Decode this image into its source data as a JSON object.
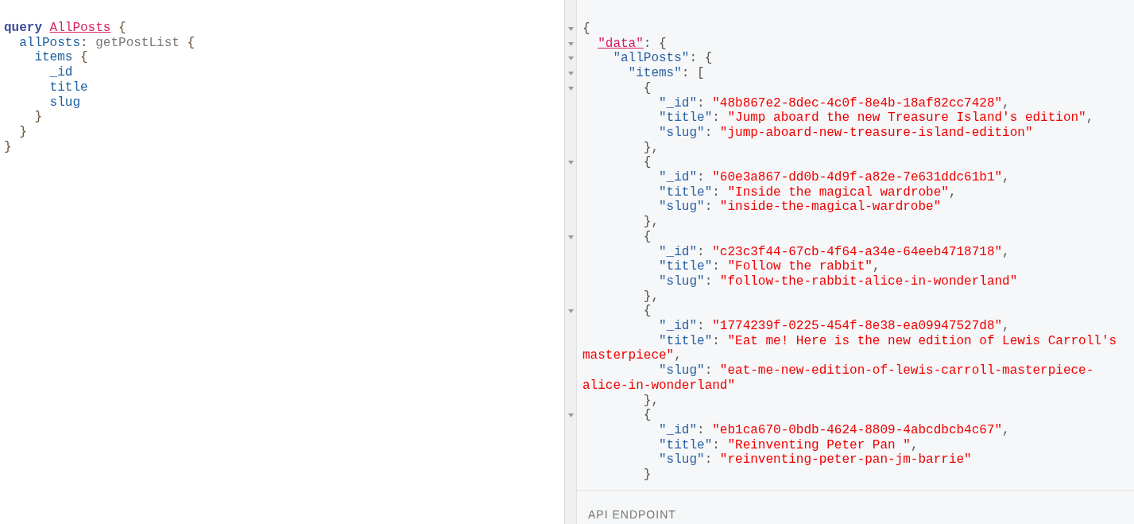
{
  "query_editor": {
    "lines": [
      {
        "tokens": [
          {
            "kind": "keyword",
            "text": "query "
          },
          {
            "kind": "def",
            "text": "AllPosts"
          },
          {
            "kind": "brace",
            "text": " {"
          }
        ],
        "children": [
          {
            "tokens": [
              {
                "kind": "alias",
                "text": "allPosts"
              },
              {
                "kind": "punct",
                "text": ": "
              },
              {
                "kind": "field",
                "text": "getPostList"
              },
              {
                "kind": "brace",
                "text": " {"
              }
            ],
            "children": [
              {
                "tokens": [
                  {
                    "kind": "property",
                    "text": "items"
                  },
                  {
                    "kind": "brace",
                    "text": " {"
                  }
                ],
                "children": [
                  {
                    "tokens": [
                      {
                        "kind": "property",
                        "text": "_id"
                      }
                    ]
                  },
                  {
                    "tokens": [
                      {
                        "kind": "property",
                        "text": "title"
                      }
                    ]
                  },
                  {
                    "tokens": [
                      {
                        "kind": "property",
                        "text": "slug"
                      }
                    ]
                  }
                ]
              },
              {
                "tokens": [
                  {
                    "kind": "brace",
                    "text": "}"
                  }
                ]
              }
            ]
          },
          {
            "tokens": [
              {
                "kind": "brace",
                "text": "}"
              }
            ]
          }
        ]
      },
      {
        "tokens": [
          {
            "kind": "brace",
            "text": "}"
          }
        ]
      }
    ]
  },
  "result_viewer": {
    "lines": [
      {
        "tokens": [
          {
            "kind": "punct",
            "text": "{"
          }
        ],
        "children": [
          {
            "tokens": [
              {
                "kind": "key_link",
                "text": "\"data\""
              },
              {
                "kind": "punct",
                "text": ": {"
              }
            ],
            "children": [
              {
                "tokens": [
                  {
                    "kind": "key",
                    "text": "\"allPosts\""
                  },
                  {
                    "kind": "punct",
                    "text": ": {"
                  }
                ],
                "children": [
                  {
                    "tokens": [
                      {
                        "kind": "key",
                        "text": "\"items\""
                      },
                      {
                        "kind": "punct",
                        "text": ": ["
                      }
                    ],
                    "children": [
                      {
                        "tokens": [
                          {
                            "kind": "punct",
                            "text": "{"
                          }
                        ],
                        "children": [
                          {
                            "tokens": [
                              {
                                "kind": "key",
                                "text": "\"_id\""
                              },
                              {
                                "kind": "punct",
                                "text": ": "
                              },
                              {
                                "kind": "string",
                                "text": "\"48b867e2-8dec-4c0f-8e4b-18af82cc7428\""
                              },
                              {
                                "kind": "punct",
                                "text": ","
                              }
                            ]
                          },
                          {
                            "tokens": [
                              {
                                "kind": "key",
                                "text": "\"title\""
                              },
                              {
                                "kind": "punct",
                                "text": ": "
                              },
                              {
                                "kind": "string",
                                "text": "\"Jump aboard the new Treasure Island's edition\""
                              },
                              {
                                "kind": "punct",
                                "text": ","
                              }
                            ]
                          },
                          {
                            "tokens": [
                              {
                                "kind": "key",
                                "text": "\"slug\""
                              },
                              {
                                "kind": "punct",
                                "text": ": "
                              },
                              {
                                "kind": "string",
                                "text": "\"jump-aboard-new-treasure-island-edition\""
                              }
                            ]
                          }
                        ]
                      },
                      {
                        "tokens": [
                          {
                            "kind": "punct",
                            "text": "},"
                          }
                        ]
                      },
                      {
                        "tokens": [
                          {
                            "kind": "punct",
                            "text": "{"
                          }
                        ],
                        "children": [
                          {
                            "tokens": [
                              {
                                "kind": "key",
                                "text": "\"_id\""
                              },
                              {
                                "kind": "punct",
                                "text": ": "
                              },
                              {
                                "kind": "string",
                                "text": "\"60e3a867-dd0b-4d9f-a82e-7e631ddc61b1\""
                              },
                              {
                                "kind": "punct",
                                "text": ","
                              }
                            ]
                          },
                          {
                            "tokens": [
                              {
                                "kind": "key",
                                "text": "\"title\""
                              },
                              {
                                "kind": "punct",
                                "text": ": "
                              },
                              {
                                "kind": "string",
                                "text": "\"Inside the magical wardrobe\""
                              },
                              {
                                "kind": "punct",
                                "text": ","
                              }
                            ]
                          },
                          {
                            "tokens": [
                              {
                                "kind": "key",
                                "text": "\"slug\""
                              },
                              {
                                "kind": "punct",
                                "text": ": "
                              },
                              {
                                "kind": "string",
                                "text": "\"inside-the-magical-wardrobe\""
                              }
                            ]
                          }
                        ]
                      },
                      {
                        "tokens": [
                          {
                            "kind": "punct",
                            "text": "},"
                          }
                        ]
                      },
                      {
                        "tokens": [
                          {
                            "kind": "punct",
                            "text": "{"
                          }
                        ],
                        "children": [
                          {
                            "tokens": [
                              {
                                "kind": "key",
                                "text": "\"_id\""
                              },
                              {
                                "kind": "punct",
                                "text": ": "
                              },
                              {
                                "kind": "string",
                                "text": "\"c23c3f44-67cb-4f64-a34e-64eeb4718718\""
                              },
                              {
                                "kind": "punct",
                                "text": ","
                              }
                            ]
                          },
                          {
                            "tokens": [
                              {
                                "kind": "key",
                                "text": "\"title\""
                              },
                              {
                                "kind": "punct",
                                "text": ": "
                              },
                              {
                                "kind": "string",
                                "text": "\"Follow the rabbit\""
                              },
                              {
                                "kind": "punct",
                                "text": ","
                              }
                            ]
                          },
                          {
                            "tokens": [
                              {
                                "kind": "key",
                                "text": "\"slug\""
                              },
                              {
                                "kind": "punct",
                                "text": ": "
                              },
                              {
                                "kind": "string",
                                "text": "\"follow-the-rabbit-alice-in-wonderland\""
                              }
                            ]
                          }
                        ]
                      },
                      {
                        "tokens": [
                          {
                            "kind": "punct",
                            "text": "},"
                          }
                        ]
                      },
                      {
                        "tokens": [
                          {
                            "kind": "punct",
                            "text": "{"
                          }
                        ],
                        "children": [
                          {
                            "tokens": [
                              {
                                "kind": "key",
                                "text": "\"_id\""
                              },
                              {
                                "kind": "punct",
                                "text": ": "
                              },
                              {
                                "kind": "string",
                                "text": "\"1774239f-0225-454f-8e38-ea09947527d8\""
                              },
                              {
                                "kind": "punct",
                                "text": ","
                              }
                            ]
                          },
                          {
                            "tokens": [
                              {
                                "kind": "key",
                                "text": "\"title\""
                              },
                              {
                                "kind": "punct",
                                "text": ": "
                              },
                              {
                                "kind": "string",
                                "text": "\"Eat me! Here is the new edition of Lewis Carroll's masterpiece\""
                              },
                              {
                                "kind": "punct",
                                "text": ","
                              }
                            ]
                          },
                          {
                            "tokens": [
                              {
                                "kind": "key",
                                "text": "\"slug\""
                              },
                              {
                                "kind": "punct",
                                "text": ": "
                              },
                              {
                                "kind": "string",
                                "text": "\"eat-me-new-edition-of-lewis-carroll-masterpiece-alice-in-wonderland\""
                              }
                            ]
                          }
                        ]
                      },
                      {
                        "tokens": [
                          {
                            "kind": "punct",
                            "text": "},"
                          }
                        ]
                      },
                      {
                        "tokens": [
                          {
                            "kind": "punct",
                            "text": "{"
                          }
                        ],
                        "children": [
                          {
                            "tokens": [
                              {
                                "kind": "key",
                                "text": "\"_id\""
                              },
                              {
                                "kind": "punct",
                                "text": ": "
                              },
                              {
                                "kind": "string",
                                "text": "\"eb1ca670-0bdb-4624-8809-4abcdbcb4c67\""
                              },
                              {
                                "kind": "punct",
                                "text": ","
                              }
                            ]
                          },
                          {
                            "tokens": [
                              {
                                "kind": "key",
                                "text": "\"title\""
                              },
                              {
                                "kind": "punct",
                                "text": ": "
                              },
                              {
                                "kind": "string",
                                "text": "\"Reinventing Peter Pan \""
                              },
                              {
                                "kind": "punct",
                                "text": ","
                              }
                            ]
                          },
                          {
                            "tokens": [
                              {
                                "kind": "key",
                                "text": "\"slug\""
                              },
                              {
                                "kind": "punct",
                                "text": ": "
                              },
                              {
                                "kind": "string",
                                "text": "\"reinventing-peter-pan-jm-barrie\""
                              }
                            ]
                          }
                        ]
                      },
                      {
                        "tokens": [
                          {
                            "kind": "punct",
                            "text": "}"
                          }
                        ]
                      }
                    ]
                  }
                ]
              }
            ]
          }
        ]
      }
    ]
  },
  "footer": {
    "label": "API ENDPOINT"
  }
}
